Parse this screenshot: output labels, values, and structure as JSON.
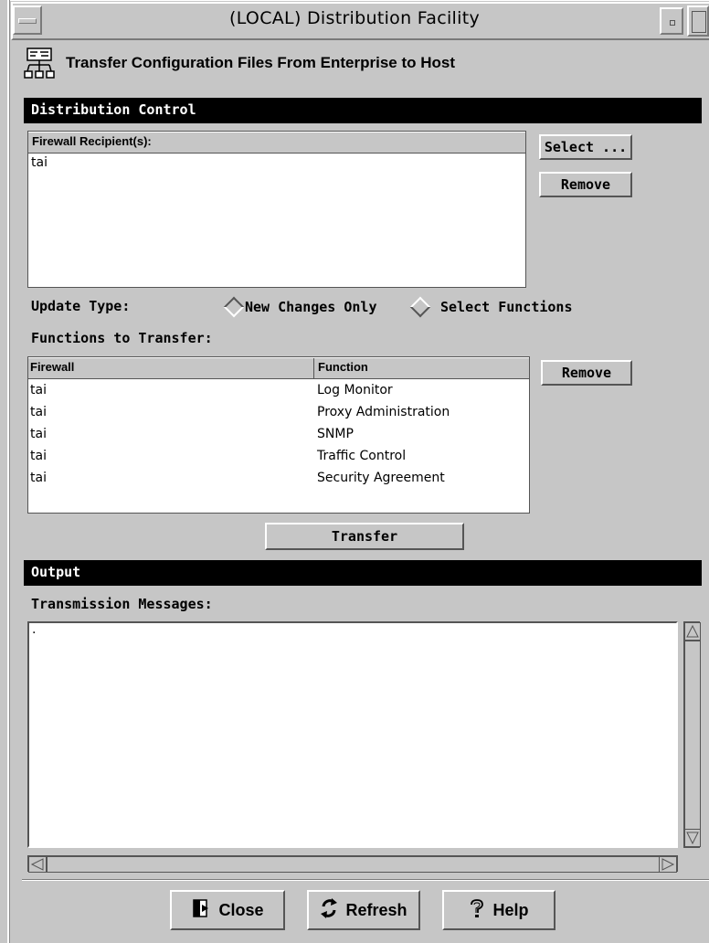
{
  "window": {
    "title": "(LOCAL) Distribution Facility"
  },
  "header": {
    "title": "Transfer Configuration Files From Enterprise to Host",
    "icon": "distribution-icon"
  },
  "distribution_control": {
    "section_title": "Distribution Control",
    "recipients_label": "Firewall Recipient(s):",
    "recipients": [
      "tai"
    ],
    "select_button": "Select ...",
    "remove_button": "Remove",
    "update_type_label": "Update Type:",
    "update_options": [
      "New Changes Only",
      "Select Functions"
    ],
    "update_selected": "New Changes Only",
    "functions_label": "Functions to Transfer:",
    "functions_columns": [
      "Firewall",
      "Function"
    ],
    "functions": [
      {
        "firewall": "tai",
        "function": "Log Monitor"
      },
      {
        "firewall": "tai",
        "function": "Proxy Administration"
      },
      {
        "firewall": "tai",
        "function": "SNMP"
      },
      {
        "firewall": "tai",
        "function": "Traffic Control"
      },
      {
        "firewall": "tai",
        "function": "Security Agreement"
      }
    ],
    "functions_remove_button": "Remove",
    "transfer_button": "Transfer"
  },
  "output": {
    "section_title": "Output",
    "messages_label": "Transmission Messages:",
    "messages_text": "."
  },
  "footer": {
    "close_label": "Close",
    "refresh_label": "Refresh",
    "help_label": "Help"
  }
}
